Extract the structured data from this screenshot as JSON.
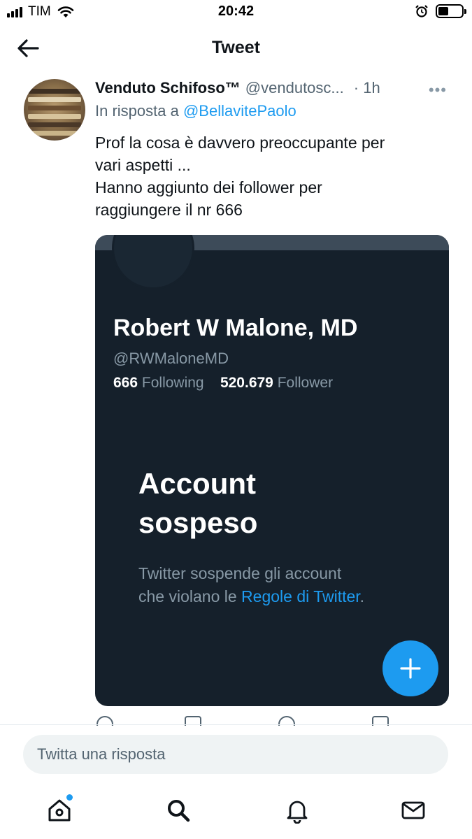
{
  "status_bar": {
    "carrier": "TIM",
    "time": "20:42",
    "icons": [
      "signal-icon",
      "wifi-icon",
      "alarm-icon",
      "battery-icon"
    ]
  },
  "nav": {
    "back_icon": "arrow-left-icon",
    "title": "Tweet"
  },
  "tweet": {
    "author_name": "Venduto Schifoso™",
    "author_handle": "@vendutosc...",
    "time": "· 1h",
    "more_icon": "more-horizontal-icon",
    "reply_prefix": "In risposta a",
    "reply_to": "@BellavitePaolo",
    "text_lines": [
      "Prof la cosa è davvero preoccupante per",
      "vari aspetti ...",
      "Hanno aggiunto dei follower per",
      "raggiungere il nr 666"
    ]
  },
  "embedded_card": {
    "profile_name": "Robert W Malone, MD",
    "profile_handle": "@RWMaloneMD",
    "following_count": "666",
    "following_label": "Following",
    "follower_count": "520.679",
    "follower_label": "Follower",
    "suspended_title_line1": "Account",
    "suspended_title_line2": "sospeso",
    "desc_line1": "Twitter sospende gli account",
    "desc_line2_prefix": "che violano le ",
    "desc_link": "Regole di Twitter",
    "desc_suffix": ".",
    "fab_icon": "plus-icon"
  },
  "reply_bar": {
    "placeholder": "Twitta una risposta"
  },
  "tab_bar": {
    "items": [
      "home-icon",
      "search-icon",
      "notifications-icon",
      "messages-icon"
    ]
  },
  "colors": {
    "accent": "#1d9bf0",
    "card_bg": "#15202b",
    "secondary_text": "#536471"
  }
}
